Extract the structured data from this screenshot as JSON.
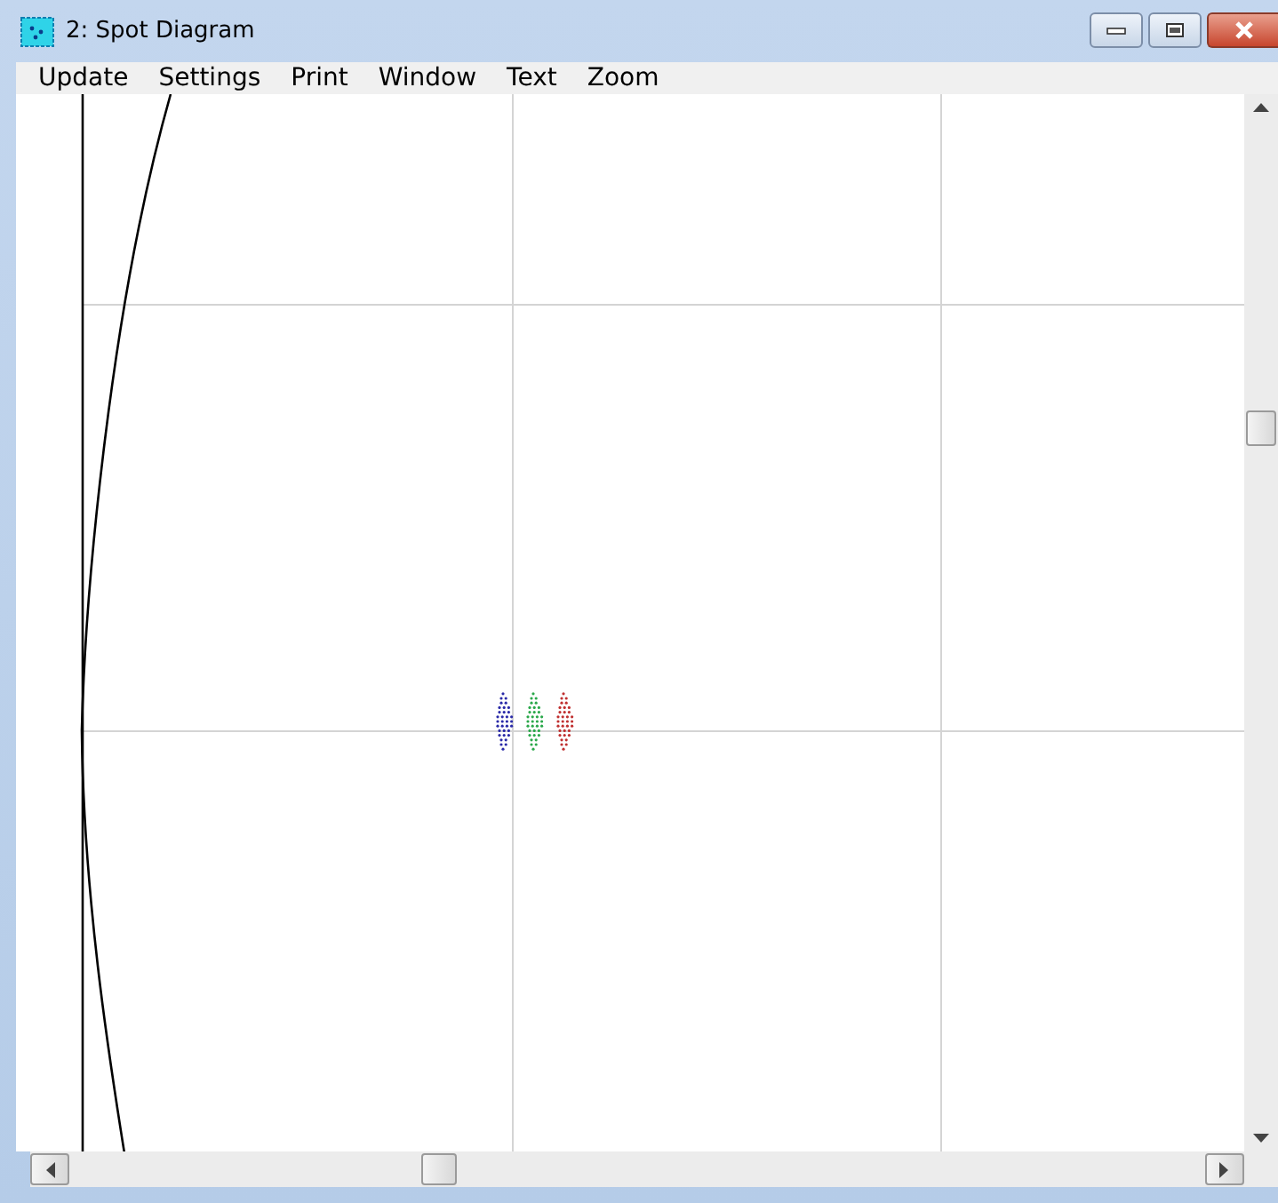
{
  "window": {
    "title": "2: Spot Diagram"
  },
  "menu": [
    "Update",
    "Settings",
    "Print",
    "Window",
    "Text",
    "Zoom"
  ]
}
